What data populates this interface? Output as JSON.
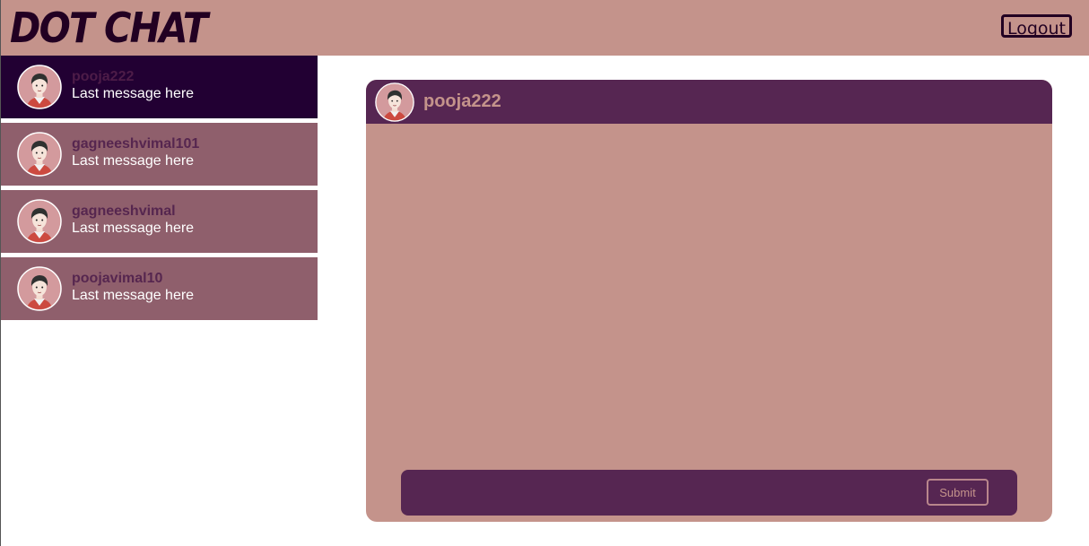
{
  "app": {
    "title": "DOT CHAT",
    "logout_label": "Logout"
  },
  "contacts": [
    {
      "name": "pooja222",
      "last_message": "Last message here",
      "active": true
    },
    {
      "name": "gagneeshvimal101",
      "last_message": "Last message here",
      "active": false
    },
    {
      "name": "gagneeshvimal",
      "last_message": "Last message here",
      "active": false
    },
    {
      "name": "poojavimal10",
      "last_message": "Last message here",
      "active": false
    }
  ],
  "chat": {
    "recipient": "pooja222",
    "input_value": "",
    "submit_label": "Submit"
  },
  "colors": {
    "header": "#c4938b",
    "dark": "#220022",
    "accent": "#562652",
    "contact": "#8f5f6c",
    "contact_active": "#220033"
  },
  "icons": {
    "avatar": "user-avatar-icon"
  }
}
